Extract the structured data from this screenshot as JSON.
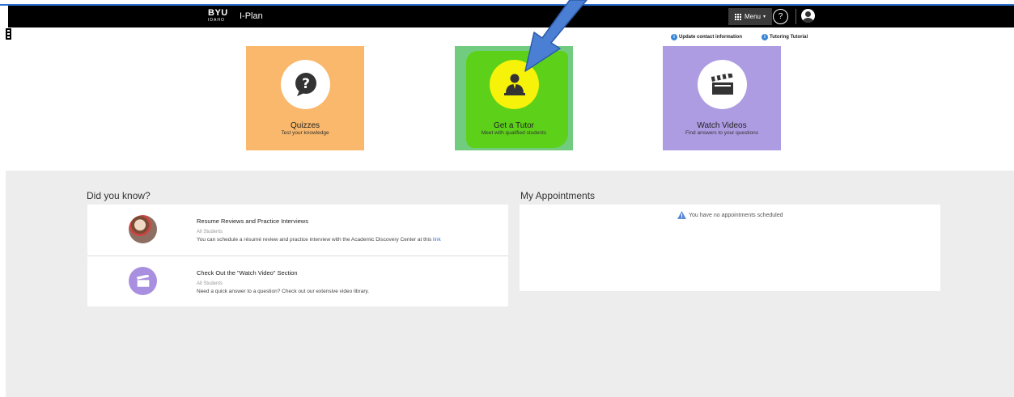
{
  "header": {
    "brand": "BYU",
    "brand_sub": "IDAHO",
    "app_title": "I-Plan",
    "menu_label": "Menu",
    "help_glyph": "?"
  },
  "quicklinks": [
    {
      "label": "Update contact information",
      "icon": "info-icon"
    },
    {
      "label": "Tutoring Tutorial",
      "icon": "info-icon"
    }
  ],
  "tiles": [
    {
      "title": "Quizzes",
      "subtitle": "Test your knowledge",
      "icon": "question-bubble-icon",
      "color": "#f9b86b"
    },
    {
      "title": "Get a Tutor",
      "subtitle": "Meet with qualified students",
      "icon": "tutor-icon",
      "color": "#5dd11a"
    },
    {
      "title": "Watch Videos",
      "subtitle": "Find answers to your questions",
      "icon": "clapperboard-icon",
      "color": "#ae9ce3"
    }
  ],
  "did_you_know": {
    "title": "Did you know?",
    "items": [
      {
        "title": "Resume Reviews and Practice Interviews",
        "audience": "All Students",
        "body": "You can schedule a résumé review and practice interview with the Academic Discovery Center at this",
        "link": "link"
      },
      {
        "title": "Check Out the \"Watch Video\" Section",
        "audience": "All Students",
        "body": "Need a quick answer to a question? Check out our extensive video library."
      }
    ]
  },
  "appointments": {
    "title": "My Appointments",
    "empty_message": "You have no appointments scheduled"
  },
  "colors": {
    "navbar": "#000000",
    "accent": "#2c6fd1",
    "arrow": "#4a7fd4",
    "band": "#ededed"
  }
}
